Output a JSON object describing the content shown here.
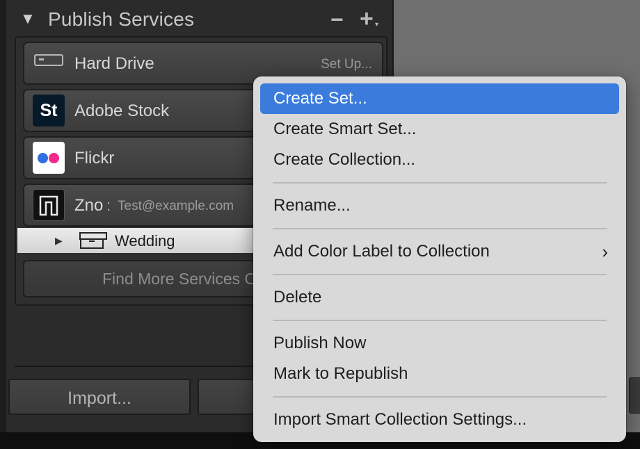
{
  "panel": {
    "title": "Publish Services",
    "collapse_glyph": "▼",
    "minus_glyph": "−",
    "plus_glyph": "+",
    "plus_caret_glyph": "▾"
  },
  "services": [
    {
      "label": "Hard Drive",
      "action": "Set Up...",
      "icon": "hard-drive-icon"
    },
    {
      "label": "Adobe Stock",
      "icon": "adobe-stock-icon",
      "icon_text": "St"
    },
    {
      "label": "Flickr",
      "icon": "flickr-icon"
    },
    {
      "label": "Zno",
      "separator": ":",
      "account": "Test@example.com",
      "icon": "zno-icon"
    }
  ],
  "collection": {
    "label": "Wedding",
    "toggle_glyph": "▶",
    "icon": "collection-set-icon"
  },
  "find_more": "Find More Services O",
  "bottom_buttons": {
    "import": "Import..."
  },
  "context_menu": {
    "items": [
      {
        "label": "Create Set...",
        "highlighted": true
      },
      {
        "label": "Create Smart Set..."
      },
      {
        "label": "Create Collection..."
      },
      {
        "label": "Rename..."
      },
      {
        "label": "Add Color Label to Collection",
        "submenu_glyph": "›"
      },
      {
        "label": "Delete"
      },
      {
        "label": "Publish Now"
      },
      {
        "label": "Mark to Republish"
      },
      {
        "label": "Import Smart Collection Settings..."
      }
    ]
  },
  "colors": {
    "highlight": "#3a7bdb",
    "menu_bg": "#d9d9d9",
    "panel_bg": "#2b2b2b",
    "flickr_blue": "#2f6fe0",
    "flickr_pink": "#f2288a",
    "stock_bg": "#061a2a"
  }
}
